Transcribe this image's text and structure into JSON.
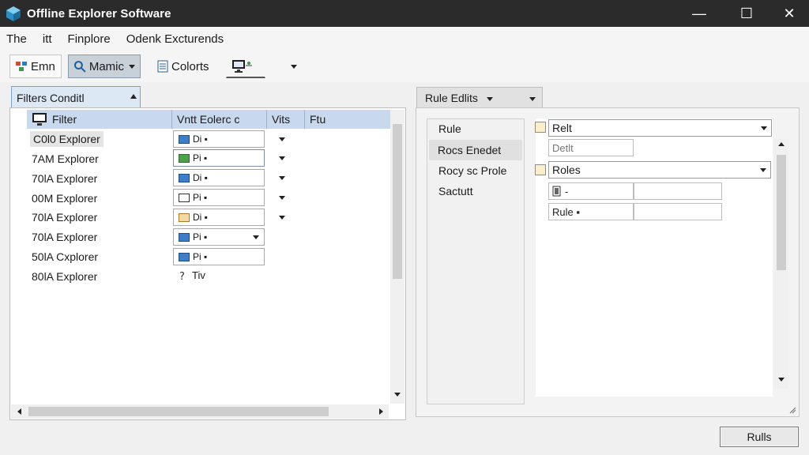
{
  "window": {
    "title": "Offline Explorer Software",
    "controls": [
      "—",
      "☐",
      "✕"
    ]
  },
  "menu": [
    "The",
    "itt",
    "Finplore",
    "Odenk Excturends"
  ],
  "toolbar": {
    "btn1": "Emn",
    "btn2": "Mamic",
    "btn3": "Colorts"
  },
  "left": {
    "tab_label": "Filters  Conditl",
    "columns": [
      "Filter",
      "Vntt Eolerc c",
      "Vits",
      "Ftu"
    ],
    "rows": [
      {
        "name": "C0l0 Explorer",
        "value": "Di ▪",
        "icon": "blue-folder"
      },
      {
        "name": "7AM Explorer",
        "value": "Pi ▪",
        "icon": "green-folder"
      },
      {
        "name": "70lA Explorer",
        "value": "Di ▪",
        "icon": "blue-folder"
      },
      {
        "name": "00M Explorer",
        "value": "Pi ▪",
        "icon": "white-folder"
      },
      {
        "name": "70lA Explorer",
        "value": "Di ▪",
        "icon": "mixed-folder"
      },
      {
        "name": "70lA Explorer",
        "value": "Pi ▪",
        "icon": "blue-folder"
      },
      {
        "name": "50lA Cxplorer",
        "value": "Pi ▪",
        "icon": "blue-folder"
      },
      {
        "name": "80lA Explorer",
        "value": "Tiv",
        "icon": "help-icon"
      }
    ]
  },
  "right": {
    "tab_label": "Rule  Edlits",
    "nav": [
      "Rule",
      "Rocs Enedet",
      "Rocy sc Prole",
      "Sactutt"
    ],
    "fields": {
      "combo1": "Relt",
      "textbox1": "Detlt",
      "combo2": "Roles",
      "tb_a_left": "-",
      "tb_b_left": "Rule ▪"
    }
  },
  "footer": {
    "button": "Rulls"
  },
  "colors": {
    "titlebar": "#2b2b2b",
    "header_blue": "#c9d9ed",
    "tab_blue": "#dde8f5"
  }
}
